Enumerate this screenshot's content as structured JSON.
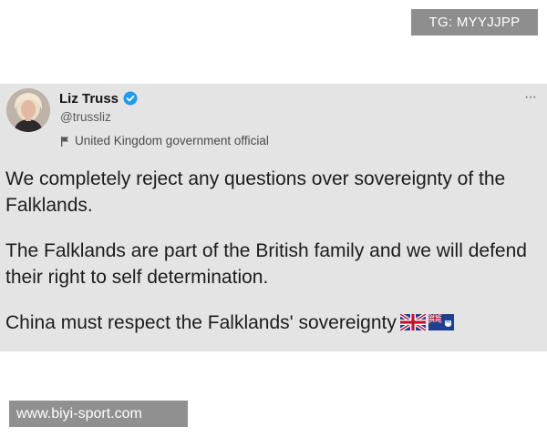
{
  "watermark_top": "TG: MYYJJPP",
  "watermark_bottom": "www.biyi-sport.com",
  "tweet": {
    "author_name": "Liz Truss",
    "handle": "@trussliz",
    "account_label": "United Kingdom government official",
    "verified_color": "#1d9bf0",
    "more_label": "···",
    "paragraphs": [
      "We completely reject any questions over sovereignty of the Falklands.",
      "The Falklands are part of the British family and we will defend their right to self determination.",
      "China must respect the Falklands' sovereignty"
    ],
    "emoji_icons": [
      "uk-flag-icon",
      "falkland-islands-flag-icon"
    ]
  }
}
